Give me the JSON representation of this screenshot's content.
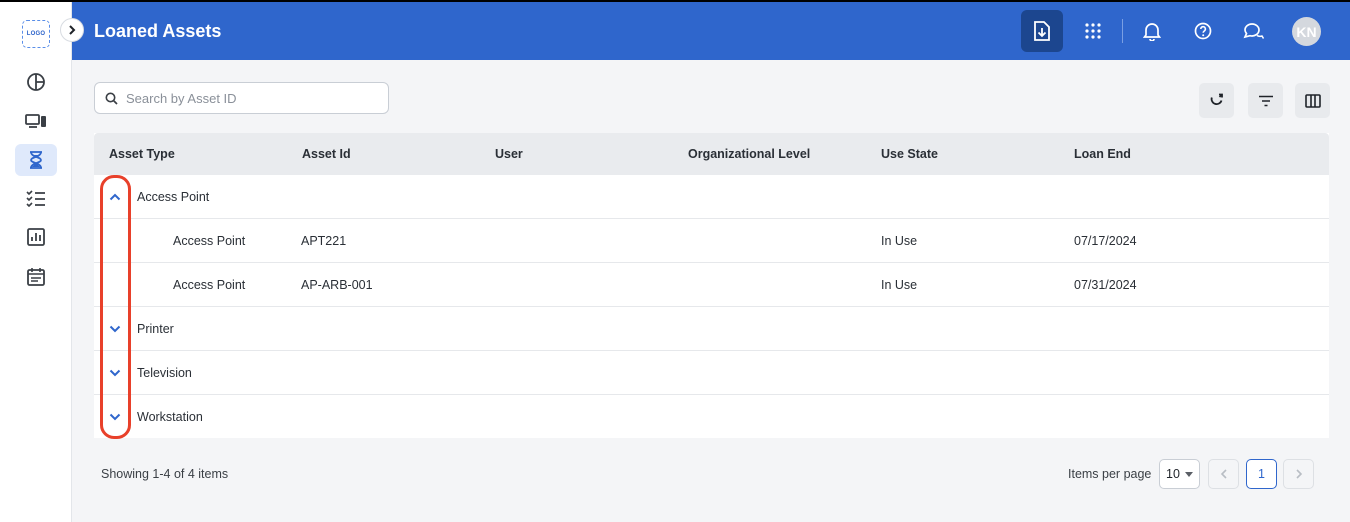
{
  "sidebar": {
    "logo_text": "LOGO",
    "items": [
      {
        "name": "dashboard",
        "icon": "pie-chart-icon"
      },
      {
        "name": "devices",
        "icon": "devices-icon"
      },
      {
        "name": "loans",
        "icon": "hourglass-icon",
        "active": true
      },
      {
        "name": "tasks",
        "icon": "checklist-icon"
      },
      {
        "name": "reports",
        "icon": "bar-chart-icon"
      },
      {
        "name": "calendar",
        "icon": "calendar-icon"
      }
    ]
  },
  "header": {
    "title": "Loaned Assets",
    "avatar_initials": "KN",
    "colors": {
      "bar": "#2f66cc",
      "export_button": "#1c468f"
    }
  },
  "search": {
    "placeholder": "Search by Asset ID",
    "value": ""
  },
  "grid": {
    "columns": [
      "Asset Type",
      "Asset Id",
      "User",
      "Organizational Level",
      "Use State",
      "Loan End"
    ],
    "groups": [
      {
        "label": "Access Point",
        "expanded": true,
        "rows": [
          {
            "asset_type": "Access Point",
            "asset_id": "APT221",
            "user": "",
            "org_level": "",
            "use_state": "In Use",
            "loan_end": "07/17/2024"
          },
          {
            "asset_type": "Access Point",
            "asset_id": "AP-ARB-001",
            "user": "",
            "org_level": "",
            "use_state": "In Use",
            "loan_end": "07/31/2024"
          }
        ]
      },
      {
        "label": "Printer",
        "expanded": false
      },
      {
        "label": "Television",
        "expanded": false
      },
      {
        "label": "Workstation",
        "expanded": false
      }
    ]
  },
  "footer": {
    "showing": "Showing 1-4 of 4 items",
    "items_per_page_label": "Items per page",
    "items_per_page": "10",
    "current_page": "1"
  },
  "highlight_color": "#e8402a"
}
